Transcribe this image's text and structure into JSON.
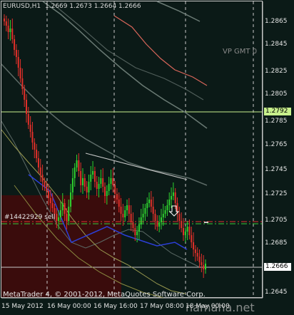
{
  "header": {
    "symbol": "EURUSD,H1",
    "ohlc": "1.2669 1.2673 1.2664 1.2666"
  },
  "annotations": {
    "vp_label": "VP GMT 0",
    "order_label": "#14422929 sell",
    "copyright": "MetaTrader 4, © 2001-2012, MetaQuotes Software Corp.",
    "watermark": "namaha.net"
  },
  "price_axis": {
    "ticks": [
      "1.2865",
      "1.2845",
      "1.2825",
      "1.2805",
      "1.2785",
      "1.2765",
      "1.2745",
      "1.2725",
      "1.2705",
      "1.2685",
      "1.2645"
    ],
    "box_labels": [
      {
        "value": "1.2792",
        "color": "#c8f08c",
        "text_color": "#000000"
      },
      {
        "value": "1.2666",
        "color": "#ffffff",
        "text_color": "#000000"
      }
    ]
  },
  "time_axis": {
    "ticks": [
      "15 May 2012",
      "16 May 00:00",
      "16 May 16:00",
      "17 May 08:00",
      "18 May 00:00"
    ]
  },
  "colors": {
    "background": "#0b1a17",
    "bull_candle": "#2fd32f",
    "bear_candle": "#e0302a",
    "grid": "#c8c8c8",
    "horizontal_level": "#c8f08c",
    "red_zone": "#3a0c0c"
  }
}
